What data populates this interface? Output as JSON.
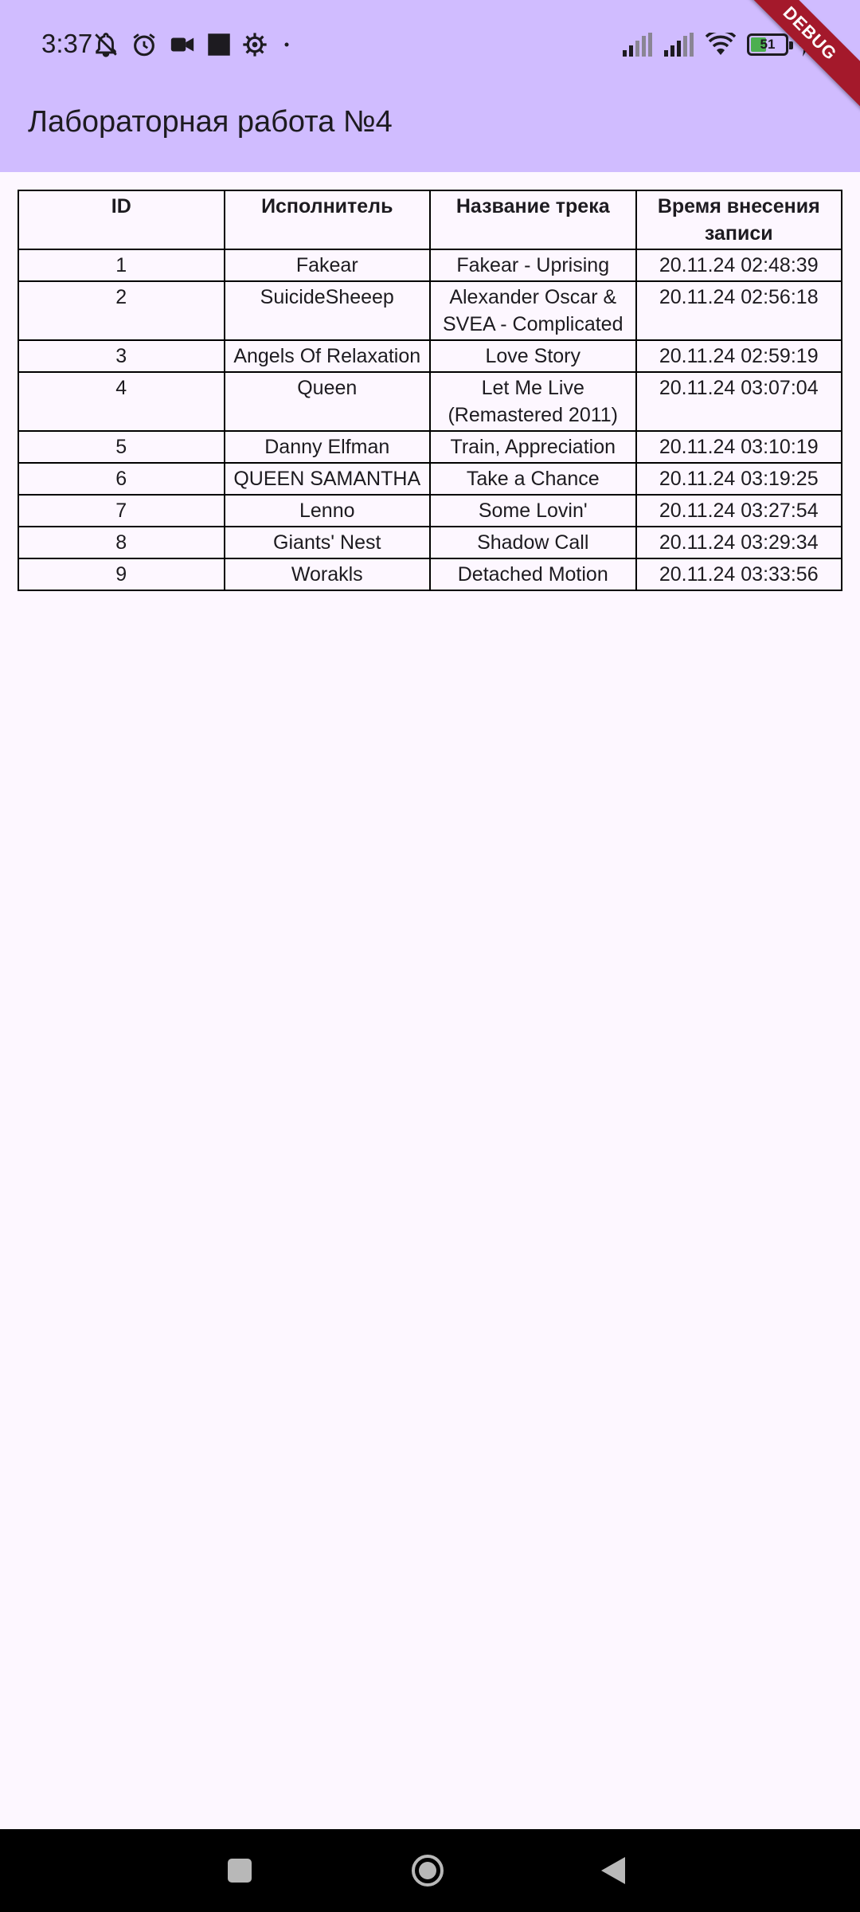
{
  "status_bar": {
    "time": "3:37",
    "battery_level": 51,
    "battery_label": "51",
    "icons": [
      "bell-off-icon",
      "alarm-icon",
      "video-icon",
      "square-icon",
      "settings-icon",
      "dot-icon",
      "signal-icon",
      "signal-icon",
      "wifi-icon",
      "battery-icon",
      "charging-icon"
    ]
  },
  "app_bar": {
    "title": "Лабораторная работа №4",
    "debug_label": "DEBUG"
  },
  "colors": {
    "app_bar": "#d0bcff",
    "background": "#fdf7ff",
    "debug_ribbon": "#a4192b",
    "nav_bar": "#000000"
  },
  "table": {
    "headers": [
      "ID",
      "Исполнитель",
      "Название трека",
      "Время внесения записи"
    ],
    "rows": [
      [
        "1",
        "Fakear",
        "Fakear - Uprising",
        "20.11.24 02:48:39"
      ],
      [
        "2",
        "SuicideSheeep",
        "Alexander Oscar & SVEA - Complicated",
        "20.11.24 02:56:18"
      ],
      [
        "3",
        "Angels Of Relaxation",
        "Love Story",
        "20.11.24 02:59:19"
      ],
      [
        "4",
        "Queen",
        "Let Me Live (Remastered 2011)",
        "20.11.24 03:07:04"
      ],
      [
        "5",
        "Danny Elfman",
        "Train, Appreciation",
        "20.11.24 03:10:19"
      ],
      [
        "6",
        "QUEEN SAMANTHA",
        "Take a Chance",
        "20.11.24 03:19:25"
      ],
      [
        "7",
        "Lenno",
        "Some Lovin'",
        "20.11.24 03:27:54"
      ],
      [
        "8",
        "Giants' Nest",
        "Shadow Call",
        "20.11.24 03:29:34"
      ],
      [
        "9",
        "Worakls",
        "Detached Motion",
        "20.11.24 03:33:56"
      ]
    ]
  },
  "nav_bar": {
    "buttons": [
      "recents-icon",
      "home-icon",
      "back-icon"
    ]
  }
}
